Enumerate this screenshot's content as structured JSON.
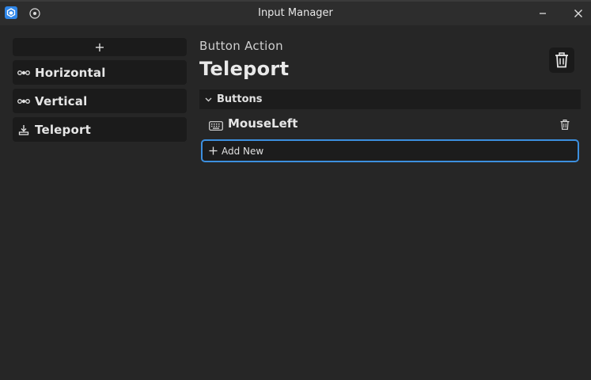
{
  "window": {
    "title": "Input Manager",
    "minimize_symbol": "—",
    "close_symbol": "✕"
  },
  "sidebar": {
    "add_symbol": "+",
    "items": [
      {
        "label": "Horizontal",
        "icon": "axis-icon"
      },
      {
        "label": "Vertical",
        "icon": "axis-icon"
      },
      {
        "label": "Teleport",
        "icon": "button-action-icon"
      }
    ]
  },
  "detail": {
    "type_label": "Button Action",
    "name": "Teleport",
    "section": {
      "title": "Buttons",
      "bindings": [
        {
          "label": "MouseLeft",
          "icon": "keyboard-icon"
        }
      ],
      "add_label": "Add New"
    }
  },
  "colors": {
    "accent": "#3c8fdf",
    "background": "#262626",
    "panel": "#1b1b1b"
  }
}
